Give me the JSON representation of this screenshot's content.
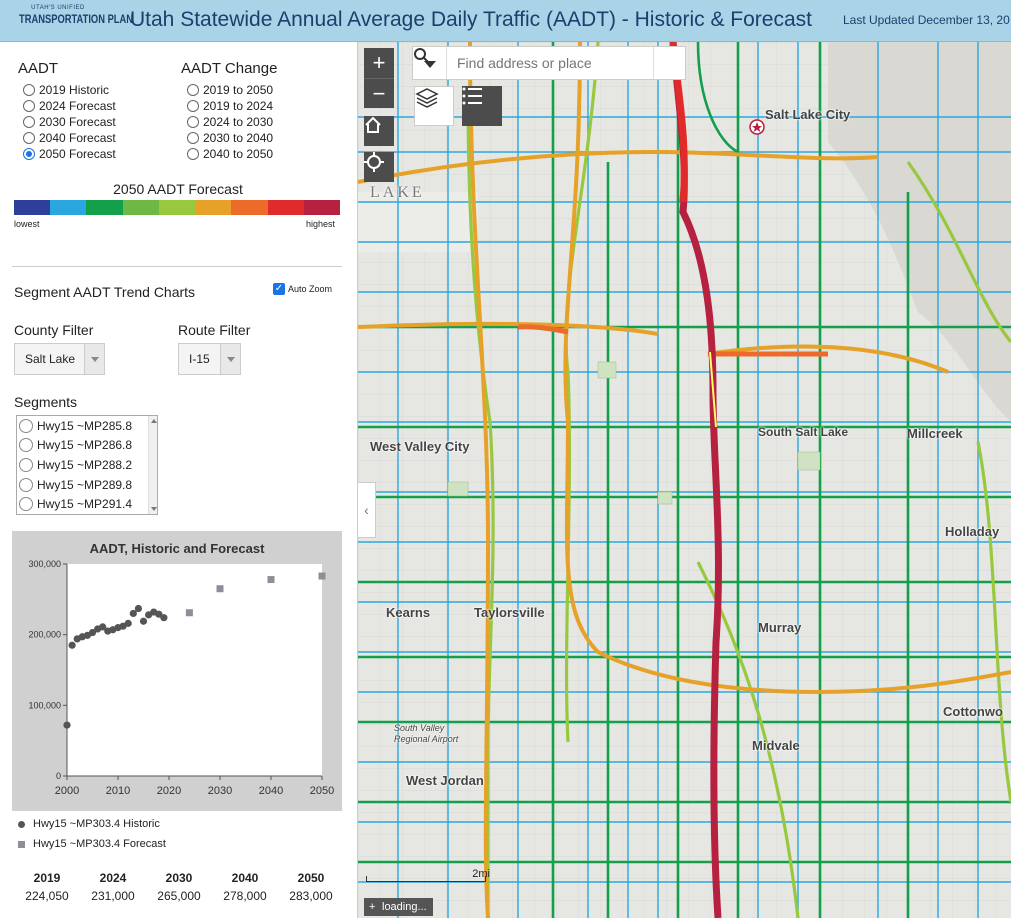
{
  "header": {
    "logo_small": "UTAH'S UNIFIED",
    "logo_big": "TRANSPORTATION PLAN",
    "title": "Utah Statewide Annual Average Daily Traffic (AADT) - Historic & Forecast",
    "last_updated": "Last Updated December 13, 20"
  },
  "aadt": {
    "title": "AADT",
    "options": [
      "2019 Historic",
      "2024 Forecast",
      "2030 Forecast",
      "2040 Forecast",
      "2050 Forecast"
    ],
    "selected": "2050 Forecast"
  },
  "aadt_change": {
    "title": "AADT Change",
    "options": [
      "2019 to 2050",
      "2019 to 2024",
      "2024 to 2030",
      "2030 to 2040",
      "2040 to 2050"
    ]
  },
  "legend": {
    "title": "2050 AADT Forecast",
    "low_label": "lowest",
    "high_label": "highest",
    "colors": [
      "#2d3f9a",
      "#2aa7e0",
      "#14a04b",
      "#6fb844",
      "#98c83f",
      "#e6a129",
      "#ec6a2a",
      "#e12a2a",
      "#b5213f"
    ]
  },
  "trend": {
    "title": "Segment AADT Trend Charts",
    "auto_zoom_label": "Auto Zoom",
    "auto_zoom_checked": true
  },
  "filters": {
    "county_label": "County Filter",
    "county_value": "Salt Lake",
    "route_label": "Route Filter",
    "route_value": "I-15"
  },
  "segments": {
    "title": "Segments",
    "items": [
      "Hwy15 ~MP285.8",
      "Hwy15 ~MP286.8",
      "Hwy15 ~MP288.2",
      "Hwy15 ~MP289.8",
      "Hwy15 ~MP291.4"
    ]
  },
  "chart_data": {
    "type": "scatter",
    "title": "AADT, Historic and Forecast",
    "xlim": [
      2000,
      2050
    ],
    "ylim": [
      0,
      300000
    ],
    "x_ticks": [
      2000,
      2010,
      2020,
      2030,
      2040,
      2050
    ],
    "y_ticks": [
      0,
      100000,
      200000,
      300000
    ],
    "y_tick_labels": [
      "0",
      "100,000",
      "200,000",
      "300,000"
    ],
    "series": [
      {
        "name": "Hwy15 ~MP303.4 Historic",
        "marker": "circle",
        "color": "#555555",
        "points": [
          [
            2000,
            72000
          ],
          [
            2001,
            185000
          ],
          [
            2002,
            194000
          ],
          [
            2003,
            197000
          ],
          [
            2004,
            199000
          ],
          [
            2005,
            203000
          ],
          [
            2006,
            208000
          ],
          [
            2007,
            211000
          ],
          [
            2008,
            205000
          ],
          [
            2009,
            207000
          ],
          [
            2010,
            210000
          ],
          [
            2011,
            212000
          ],
          [
            2012,
            216000
          ],
          [
            2013,
            230000
          ],
          [
            2014,
            237000
          ],
          [
            2015,
            219000
          ],
          [
            2016,
            228000
          ],
          [
            2017,
            232000
          ],
          [
            2018,
            229000
          ],
          [
            2019,
            224050
          ]
        ]
      },
      {
        "name": "Hwy15 ~MP303.4 Forecast",
        "marker": "square",
        "color": "#8a8f98",
        "points": [
          [
            2024,
            231000
          ],
          [
            2030,
            265000
          ],
          [
            2040,
            278000
          ],
          [
            2050,
            283000
          ]
        ]
      }
    ]
  },
  "summary": {
    "years": [
      "2019",
      "2024",
      "2030",
      "2040",
      "2050"
    ],
    "values": [
      "224,050",
      "231,000",
      "265,000",
      "278,000",
      "283,000"
    ]
  },
  "map": {
    "search_placeholder": "Find address or place",
    "labels": [
      "Salt Lake City",
      "LAKE",
      "West Valley City",
      "South Salt Lake",
      "Millcreek",
      "Holladay",
      "Kearns",
      "Taylorsville",
      "Murray",
      "Cottonwo",
      "South Valley Regional Airport",
      "Midvale",
      "West Jordan"
    ],
    "scale_label": "2mi",
    "loading_text": "loading..."
  }
}
